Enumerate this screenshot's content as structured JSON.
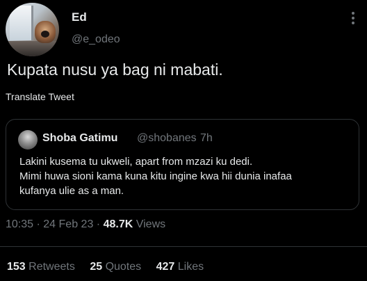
{
  "author": {
    "name": "Ed",
    "handle": "@e_odeo"
  },
  "tweet": {
    "text": "Kupata nusu ya bag ni mabati.",
    "translate_label": "Translate Tweet"
  },
  "quoted": {
    "name": "Shoba Gatimu",
    "handle": "@shobanes",
    "separator": "·",
    "time": "7h",
    "lines": [
      "Lakini kusema tu ukweli, apart from mzazi ku dedi.",
      "Mimi huwa sioni kama kuna kitu ingine kwa hii dunia inafaa",
      "kufanya ulie as a man."
    ]
  },
  "meta": {
    "time": "10:35",
    "sep1": "·",
    "date": "24 Feb 23",
    "sep2": "·",
    "views_count": "48.7K",
    "views_label": "Views"
  },
  "stats": {
    "retweets_count": "153",
    "retweets_label": "Retweets",
    "quotes_count": "25",
    "quotes_label": "Quotes",
    "likes_count": "427",
    "likes_label": "Likes"
  }
}
